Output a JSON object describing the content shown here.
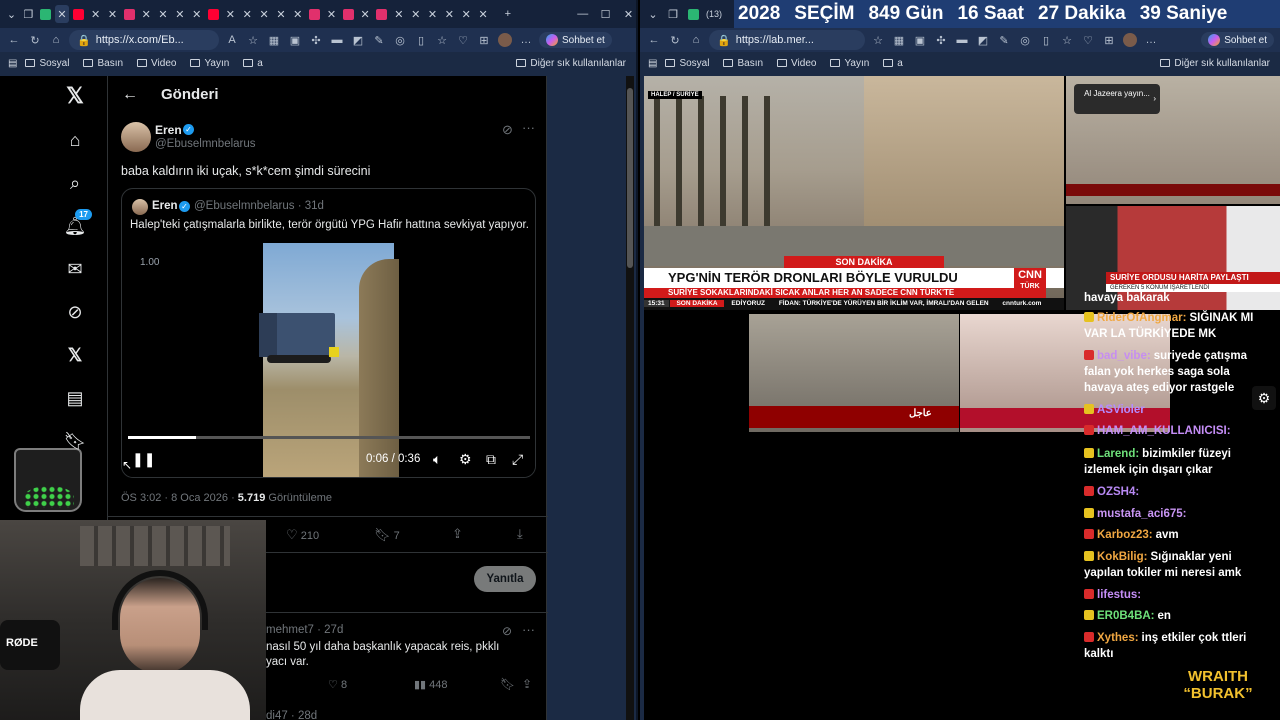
{
  "left_browser": {
    "url": "https://x.com/Eb...",
    "chat_button": "Sohbet et",
    "bookmarks": [
      "Sosyal",
      "Basın",
      "Video",
      "Yayın",
      "a"
    ],
    "bookmarks_other": "Diğer sık kullanılanlar"
  },
  "right_browser": {
    "tab_count": "(13)",
    "url": "https://lab.mer...",
    "chat_button": "Sohbet et",
    "bookmarks": [
      "Sosyal",
      "Basın",
      "Video",
      "Yayın",
      "a"
    ],
    "bookmarks_other": "Diğer sık kullanılanlar"
  },
  "countdown": {
    "year": "2028",
    "label": "SEÇİM",
    "days": "849 Gün",
    "hours": "16 Saat",
    "minutes": "27 Dakika",
    "seconds": "39 Saniye"
  },
  "x_nav": {
    "notification_count": "17"
  },
  "post": {
    "header": "Gönderi",
    "author_name": "Eren",
    "author_handle": "@Ebuselmnbelarus",
    "text": "baba kaldırın iki uçak, s*k*cem şimdi sürecini",
    "quote": {
      "author_name": "Eren",
      "author_handle": "@Ebuselmnbelarus",
      "age": "· 31d",
      "text": "Halep'teki çatışmalarla birlikte, terör örgütü YPG Hafir hattına sevkiyat yapıyor."
    },
    "video": {
      "speed": "1.00",
      "time": "0:06 / 0:36",
      "progress": 0.17
    },
    "timestamp": "ÖS 3:02 · 8 Oca 2026 ·",
    "views_count": "5.719",
    "views_label": "Görüntüleme",
    "likes": "210",
    "bookmarks": "7",
    "reply_button": "Yanıtla"
  },
  "reply_preview": {
    "handle": "mehmet7 · 27d",
    "text_line1": "nasıl 50 yıl daha başkanlık yapacak reis, pkklı",
    "text_line2": "yacı var.",
    "likes": "8",
    "views": "448",
    "next_handle": "di47 · 28d"
  },
  "news": {
    "location_tag": "HALEP / SURİYE",
    "banner_top": "SON DAKİKA",
    "headline": "YPG'NİN TERÖR DRONLARI BÖYLE VURULDU",
    "subheadline": "SURİYE SOKAKLARINDAKİ SICAK ANLAR HER AN SADECE CNN TÜRK'TE",
    "ticker_time": "15:31",
    "ticker_items": [
      "SON DAKİKA",
      "EDİYORUZ",
      "FİDAN: TÜRKİYE'DE YÜRÜYEN BİR İKLİM VAR, İMRALI'DAN GELEN",
      "cnnturk.com"
    ],
    "cnn_logo_top": "CNN",
    "cnn_logo_bottom": "TÜRK",
    "aljazeera_popup": "Al Jazeera yayın...",
    "haber_banner": "SURİYE ORDUSU HARİTA PAYLAŞTI",
    "haber_sub": "GEREKEN 5 KONUM İŞARETLENDİ",
    "arabic_banner": "عاجل"
  },
  "chat": [
    {
      "user": "",
      "msg": "havaya bakarak",
      "color": "#ffffff"
    },
    {
      "user": "RiderOfAngmar:",
      "msg": "SIĞINAK MI VAR LA TÜRKİYEDE MK",
      "color": "#f0a742"
    },
    {
      "user": "bad_vibe:",
      "msg": "suriyede çatışma falan yok herkes saga sola havaya ateş ediyor rastgele",
      "color": "#c68ef0"
    },
    {
      "user": "ASVioler",
      "msg": "",
      "color": "#b58cff"
    },
    {
      "user": "HAM_AM_KULLANICISI:",
      "msg": "",
      "color": "#c58ef7"
    },
    {
      "user": "Larend:",
      "msg": "bizimkiler füzeyi izlemek için dışarı çıkar",
      "color": "#6ee07a"
    },
    {
      "user": "OZSH4:",
      "msg": "",
      "color": "#b889f4"
    },
    {
      "user": "mustafa_aci675:",
      "msg": "",
      "color": "#c895f3"
    },
    {
      "user": "Karboz23:",
      "msg": "avm",
      "color": "#f0a742"
    },
    {
      "user": "KokBilig:",
      "msg": "Sığınaklar yeni yapılan tokiler mi neresi amk",
      "color": "#f0a742"
    },
    {
      "user": "lifestus:",
      "msg": "",
      "color": "#c58ef7"
    },
    {
      "user": "ER0B4BA:",
      "msg": "en",
      "color": "#6ee07a"
    },
    {
      "user": "Xythes:",
      "msg": "inş etkiler çok ttleri kalktı",
      "color": "#f0a742"
    }
  ],
  "overlay": {
    "mic_brand": "RØDE",
    "streamer_line1": "WRAITH",
    "streamer_line2": "BURAK"
  },
  "colors": {
    "accent_blue": "#1d9bf0",
    "cnn_red": "#d11a1a",
    "countdown_bg": "#1f3d73",
    "browser_bg": "#1b2a44"
  }
}
